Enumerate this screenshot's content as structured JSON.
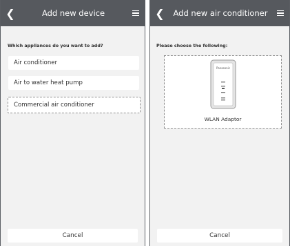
{
  "left_screen": {
    "header": {
      "back_icon": "chevron-left-icon",
      "title": "Add new device",
      "menu_icon": "hamburger-menu-icon"
    },
    "question": "Which appliances do you want to add?",
    "options": [
      {
        "label": "Air conditioner"
      },
      {
        "label": "Air to water heat pump"
      },
      {
        "label": "Commercial air conditioner",
        "selected": true
      }
    ],
    "cancel_label": "Cancel"
  },
  "right_screen": {
    "header": {
      "back_icon": "chevron-left-icon",
      "title": "Add new air conditioner",
      "menu_icon": "hamburger-menu-icon"
    },
    "prompt": "Please choose the following:",
    "device": {
      "brand": "Panasonic",
      "caption": "WLAN Adaptor"
    },
    "cancel_label": "Cancel"
  },
  "colors": {
    "header_bg": "#56595e",
    "screen_bg": "#f2f2f2",
    "dashed_border": "#8d8d8d"
  }
}
